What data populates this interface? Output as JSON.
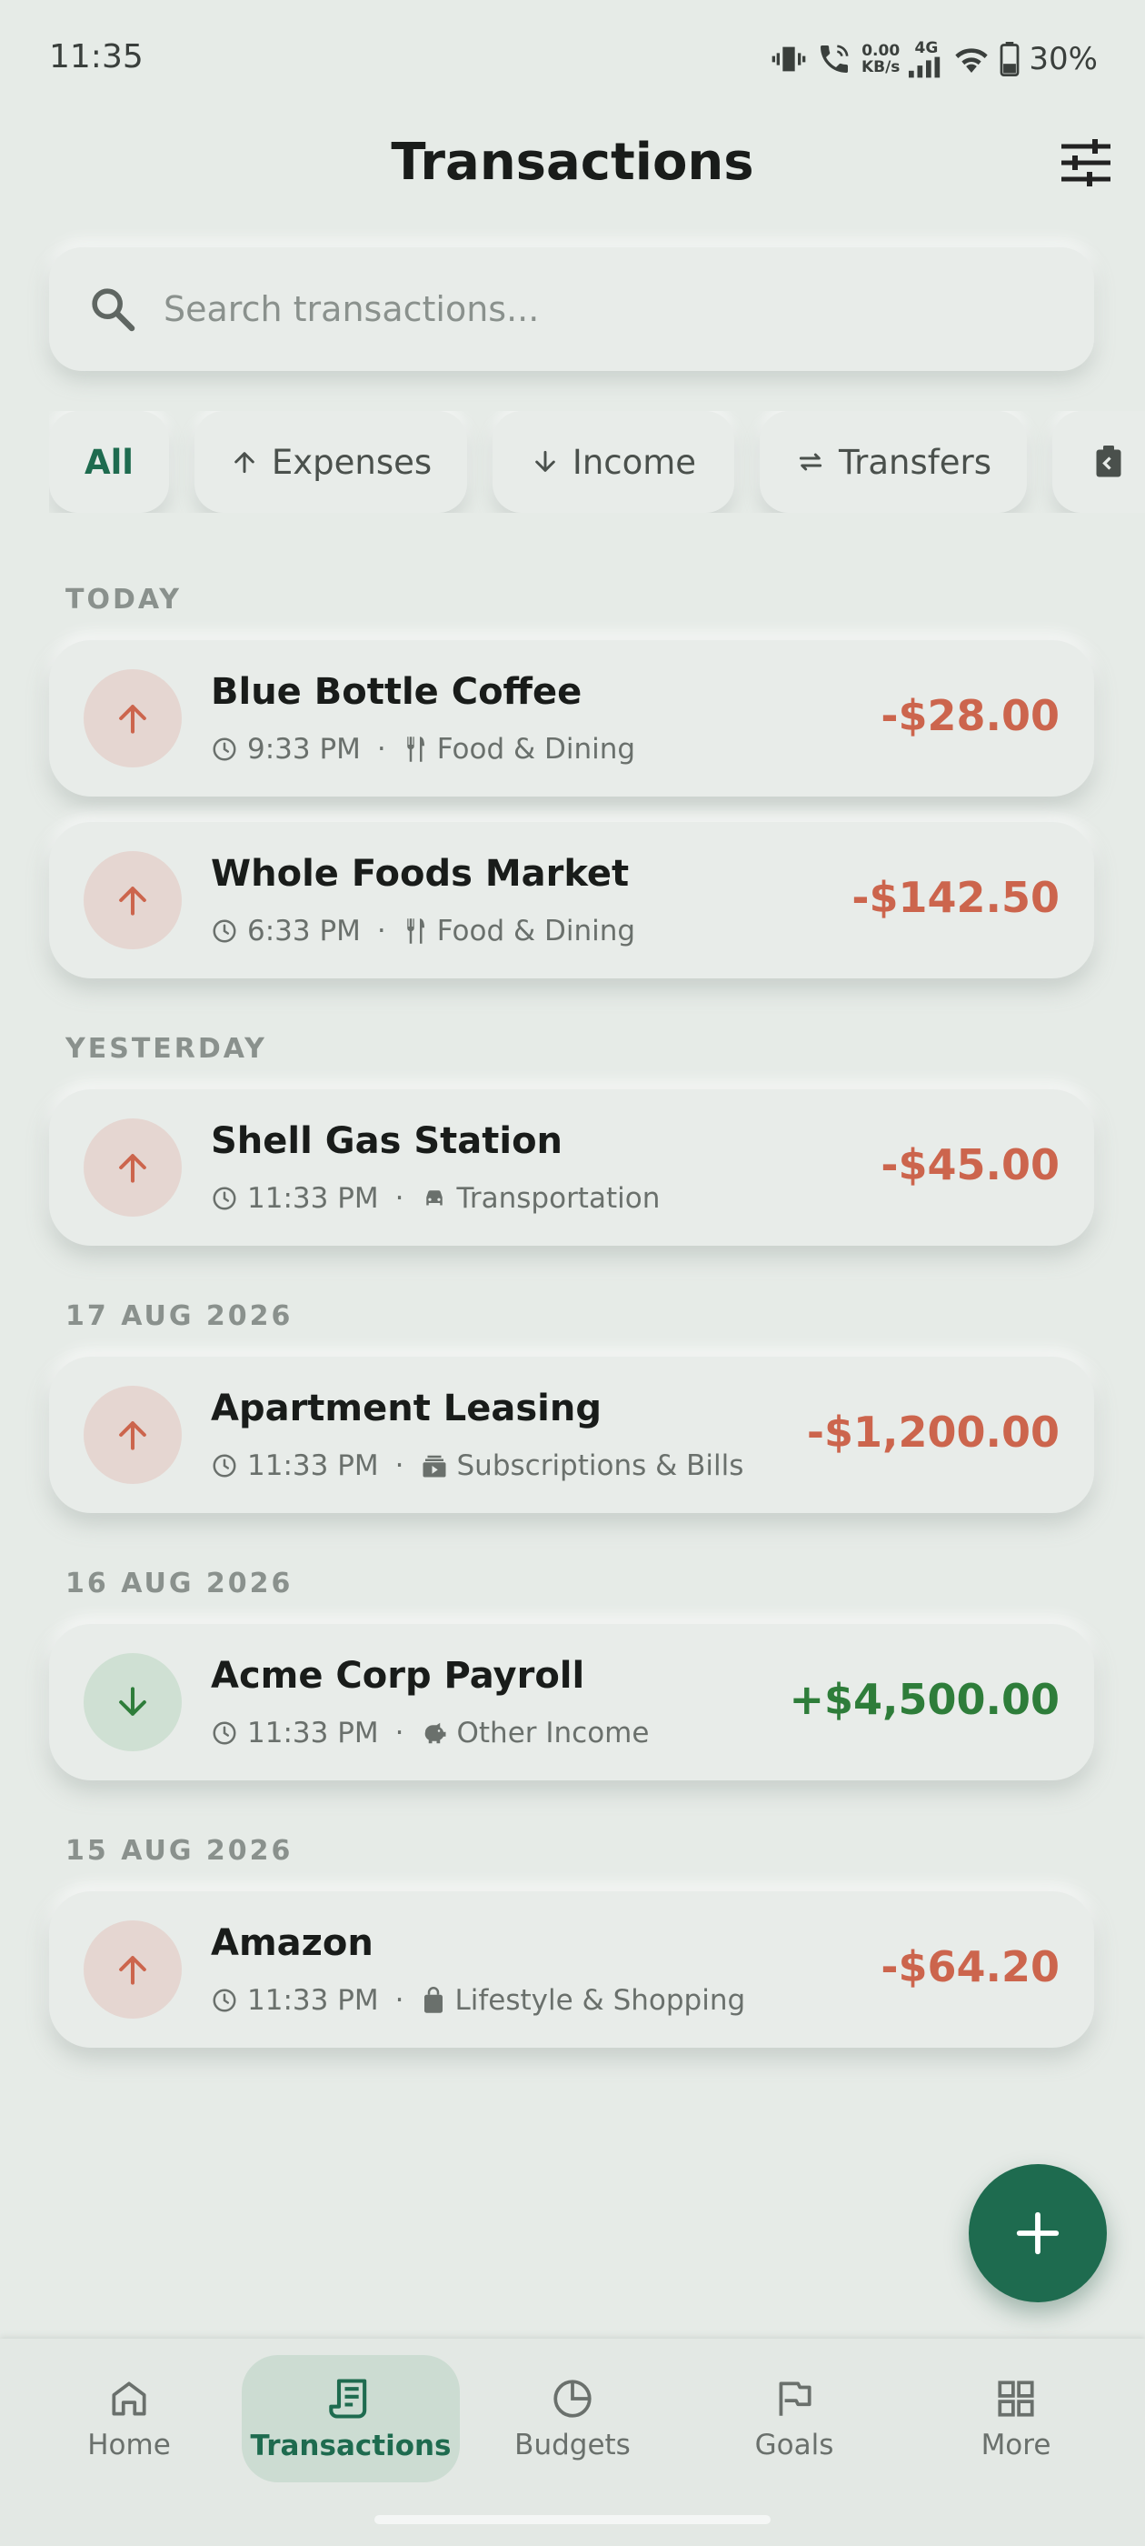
{
  "status_bar": {
    "time": "11:35",
    "speed_value": "0.00",
    "speed_unit": "KB/s",
    "network": "4G",
    "battery": "30%"
  },
  "header": {
    "title": "Transactions",
    "filter_icon": "tune-icon"
  },
  "search": {
    "placeholder": "Search transactions...",
    "value": ""
  },
  "chips": [
    {
      "label": "All",
      "icon": ""
    },
    {
      "label": "Expenses",
      "icon": "arrow-up-icon"
    },
    {
      "label": "Income",
      "icon": "arrow-down-icon"
    },
    {
      "label": "Transfers",
      "icon": "swap-icon"
    },
    {
      "label": "",
      "icon": "clipboard-icon"
    }
  ],
  "sections": [
    {
      "label": "TODAY",
      "transactions": [
        {
          "name": "Blue Bottle Coffee",
          "time": "9:33 PM",
          "category": "Food & Dining",
          "category_icon": "utensils-icon",
          "amount": "-$28.00",
          "kind": "expense"
        },
        {
          "name": "Whole Foods Market",
          "time": "6:33 PM",
          "category": "Food & Dining",
          "category_icon": "utensils-icon",
          "amount": "-$142.50",
          "kind": "expense"
        }
      ]
    },
    {
      "label": "YESTERDAY",
      "transactions": [
        {
          "name": "Shell Gas Station",
          "time": "11:33 PM",
          "category": "Transportation",
          "category_icon": "car-icon",
          "amount": "-$45.00",
          "kind": "expense"
        }
      ]
    },
    {
      "label": "17 AUG 2026",
      "transactions": [
        {
          "name": "Apartment Leasing",
          "time": "11:33 PM",
          "category": "Subscriptions & Bills",
          "category_icon": "subscriptions-icon",
          "amount": "-$1,200.00",
          "kind": "expense"
        }
      ]
    },
    {
      "label": "16 AUG 2026",
      "transactions": [
        {
          "name": "Acme Corp Payroll",
          "time": "11:33 PM",
          "category": "Other Income",
          "category_icon": "piggy-bank-icon",
          "amount": "+$4,500.00",
          "kind": "income"
        }
      ]
    },
    {
      "label": "15 AUG 2026",
      "transactions": [
        {
          "name": "Amazon",
          "time": "11:33 PM",
          "category": "Lifestyle & Shopping",
          "category_icon": "shopping-bag-icon",
          "amount": "-$64.20",
          "kind": "expense"
        }
      ]
    }
  ],
  "fab": {
    "icon": "plus-icon"
  },
  "nav": [
    {
      "label": "Home",
      "icon": "home-icon"
    },
    {
      "label": "Transactions",
      "icon": "receipt-icon",
      "active": true
    },
    {
      "label": "Budgets",
      "icon": "pie-chart-icon"
    },
    {
      "label": "Goals",
      "icon": "flag-icon"
    },
    {
      "label": "More",
      "icon": "grid-icon"
    }
  ],
  "colors": {
    "accent": "#1e6b4f",
    "expense": "#cc654d",
    "income": "#2e7d3a",
    "background": "#e6ebe7"
  }
}
